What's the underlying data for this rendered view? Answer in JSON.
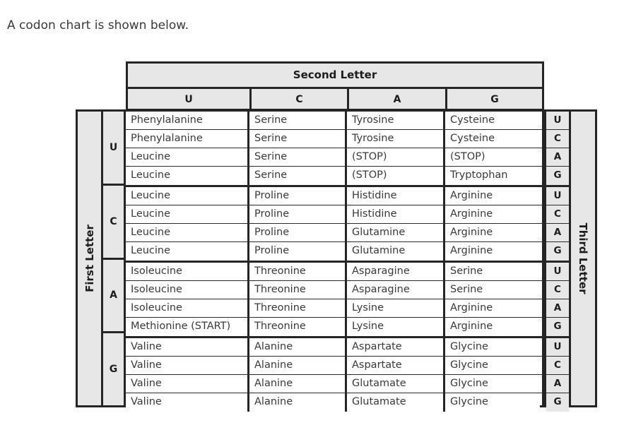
{
  "intro": {
    "text": "A codon chart is shown below."
  },
  "labels": {
    "second_letter": "Second Letter",
    "first_letter": "First Letter",
    "third_letter": "Third Letter"
  },
  "colors": {
    "header_fill": "#e7e7e7",
    "cell_fill": "#ffffff",
    "border": "#252525",
    "text": "#3a3a3a",
    "header_text": "#1c1c1c",
    "page_background": "#ffffff"
  },
  "chart_data": {
    "type": "table",
    "title": "Codon Chart",
    "second_letters": [
      "U",
      "C",
      "A",
      "G"
    ],
    "first_letters": [
      "U",
      "C",
      "A",
      "G"
    ],
    "third_letters": [
      "U",
      "C",
      "A",
      "G"
    ],
    "groups": [
      {
        "first_letter": "U",
        "rows": [
          {
            "third_letter": "U",
            "cells": [
              "Phenylalanine",
              "Serine",
              "Tyrosine",
              "Cysteine"
            ]
          },
          {
            "third_letter": "C",
            "cells": [
              "Phenylalanine",
              "Serine",
              "Tyrosine",
              "Cysteine"
            ]
          },
          {
            "third_letter": "A",
            "cells": [
              "Leucine",
              "Serine",
              "(STOP)",
              "(STOP)"
            ]
          },
          {
            "third_letter": "G",
            "cells": [
              "Leucine",
              "Serine",
              "(STOP)",
              "Tryptophan"
            ]
          }
        ]
      },
      {
        "first_letter": "C",
        "rows": [
          {
            "third_letter": "U",
            "cells": [
              "Leucine",
              "Proline",
              "Histidine",
              "Arginine"
            ]
          },
          {
            "third_letter": "C",
            "cells": [
              "Leucine",
              "Proline",
              "Histidine",
              "Arginine"
            ]
          },
          {
            "third_letter": "A",
            "cells": [
              "Leucine",
              "Proline",
              "Glutamine",
              "Arginine"
            ]
          },
          {
            "third_letter": "G",
            "cells": [
              "Leucine",
              "Proline",
              "Glutamine",
              "Arginine"
            ]
          }
        ]
      },
      {
        "first_letter": "A",
        "rows": [
          {
            "third_letter": "U",
            "cells": [
              "Isoleucine",
              "Threonine",
              "Asparagine",
              "Serine"
            ]
          },
          {
            "third_letter": "C",
            "cells": [
              "Isoleucine",
              "Threonine",
              "Asparagine",
              "Serine"
            ]
          },
          {
            "third_letter": "A",
            "cells": [
              "Isoleucine",
              "Threonine",
              "Lysine",
              "Arginine"
            ]
          },
          {
            "third_letter": "G",
            "cells": [
              "Methionine (START)",
              "Threonine",
              "Lysine",
              "Arginine"
            ]
          }
        ]
      },
      {
        "first_letter": "G",
        "rows": [
          {
            "third_letter": "U",
            "cells": [
              "Valine",
              "Alanine",
              "Aspartate",
              "Glycine"
            ]
          },
          {
            "third_letter": "C",
            "cells": [
              "Valine",
              "Alanine",
              "Aspartate",
              "Glycine"
            ]
          },
          {
            "third_letter": "A",
            "cells": [
              "Valine",
              "Alanine",
              "Glutamate",
              "Glycine"
            ]
          },
          {
            "third_letter": "G",
            "cells": [
              "Valine",
              "Alanine",
              "Glutamate",
              "Glycine"
            ]
          }
        ]
      }
    ]
  }
}
